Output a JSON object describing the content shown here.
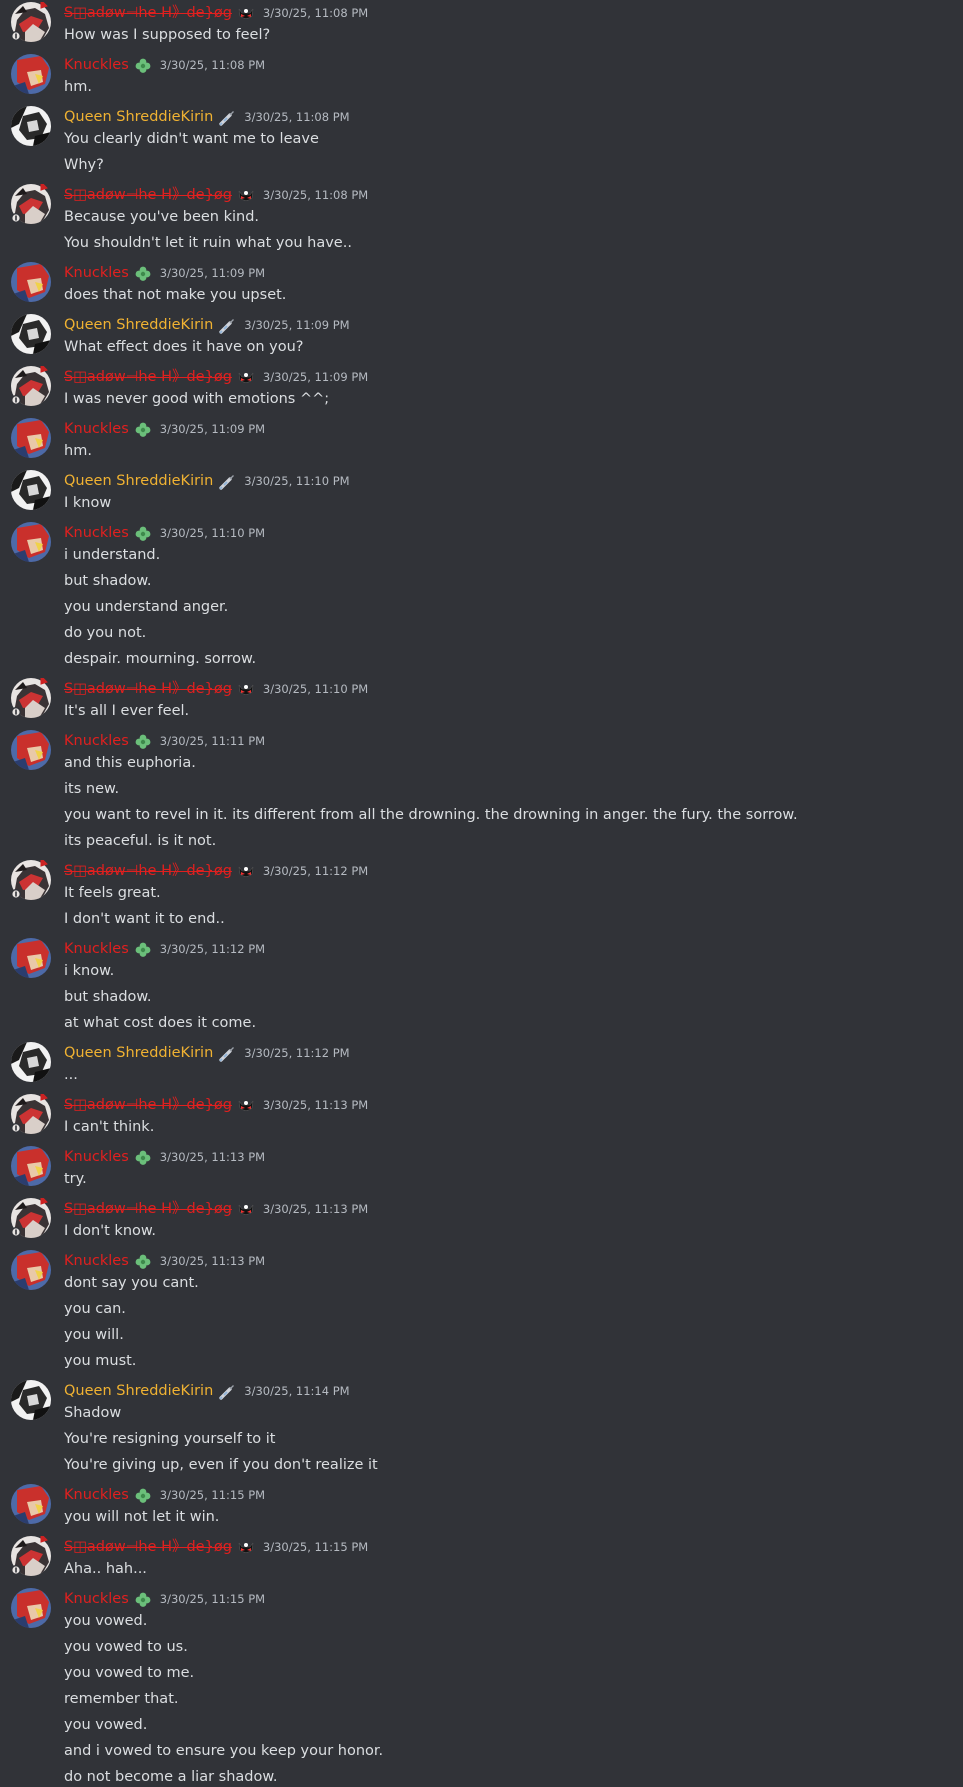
{
  "users": {
    "shadow": {
      "name": "S◫adøw⊣he H》de}øg",
      "color": "#e0201f",
      "strike": true,
      "badge": "cat-mask-icon",
      "avatar": "shadow-avatar"
    },
    "knuckles": {
      "name": "Knuckles",
      "color": "#e0201f",
      "strike": false,
      "badge": "green-flower-icon",
      "avatar": "knuckles-avatar"
    },
    "queen": {
      "name": "Queen ShreddieKirin",
      "color": "#f0b232",
      "strike": false,
      "badge": "syringe-icon",
      "avatar": "queen-avatar"
    }
  },
  "messages": [
    {
      "user": "shadow",
      "time": "3/30/25, 11:08 PM",
      "lines": [
        "How was I supposed to feel?"
      ]
    },
    {
      "user": "knuckles",
      "time": "3/30/25, 11:08 PM",
      "lines": [
        "hm."
      ]
    },
    {
      "user": "queen",
      "time": "3/30/25, 11:08 PM",
      "lines": [
        "You clearly didn't want me to leave",
        "Why?"
      ]
    },
    {
      "user": "shadow",
      "time": "3/30/25, 11:08 PM",
      "lines": [
        "Because you've been kind.",
        "You shouldn't let it ruin what you have.."
      ]
    },
    {
      "user": "knuckles",
      "time": "3/30/25, 11:09 PM",
      "lines": [
        "does that not make you upset."
      ]
    },
    {
      "user": "queen",
      "time": "3/30/25, 11:09 PM",
      "lines": [
        "What effect does it have on you?"
      ]
    },
    {
      "user": "shadow",
      "time": "3/30/25, 11:09 PM",
      "lines": [
        "I was never good with emotions ^^;"
      ]
    },
    {
      "user": "knuckles",
      "time": "3/30/25, 11:09 PM",
      "lines": [
        "hm."
      ]
    },
    {
      "user": "queen",
      "time": "3/30/25, 11:10 PM",
      "lines": [
        "I know"
      ]
    },
    {
      "user": "knuckles",
      "time": "3/30/25, 11:10 PM",
      "lines": [
        "i understand.",
        "but shadow.",
        "you understand anger.",
        "do you not.",
        "despair. mourning. sorrow."
      ]
    },
    {
      "user": "shadow",
      "time": "3/30/25, 11:10 PM",
      "lines": [
        "It's all I ever feel."
      ]
    },
    {
      "user": "knuckles",
      "time": "3/30/25, 11:11 PM",
      "lines": [
        "and this euphoria.",
        "its new.",
        "you want to revel in it. its different from all the drowning. the drowning in anger. the fury. the sorrow.",
        "its peaceful. is it not."
      ]
    },
    {
      "user": "shadow",
      "time": "3/30/25, 11:12 PM",
      "lines": [
        "It feels great.",
        "I don't want it to end.."
      ]
    },
    {
      "user": "knuckles",
      "time": "3/30/25, 11:12 PM",
      "lines": [
        "i know.",
        "but shadow.",
        "at what cost does it come."
      ]
    },
    {
      "user": "queen",
      "time": "3/30/25, 11:12 PM",
      "lines": [
        "..."
      ]
    },
    {
      "user": "shadow",
      "time": "3/30/25, 11:13 PM",
      "lines": [
        "I can't think."
      ]
    },
    {
      "user": "knuckles",
      "time": "3/30/25, 11:13 PM",
      "lines": [
        "try."
      ]
    },
    {
      "user": "shadow",
      "time": "3/30/25, 11:13 PM",
      "lines": [
        "I don't know."
      ]
    },
    {
      "user": "knuckles",
      "time": "3/30/25, 11:13 PM",
      "lines": [
        "dont say you cant.",
        "you can.",
        "you will.",
        "you must."
      ]
    },
    {
      "user": "queen",
      "time": "3/30/25, 11:14 PM",
      "lines": [
        "Shadow",
        "You're resigning yourself to it",
        "You're giving up, even if you don't realize it"
      ]
    },
    {
      "user": "knuckles",
      "time": "3/30/25, 11:15 PM",
      "lines": [
        "you will not let it win."
      ]
    },
    {
      "user": "shadow",
      "time": "3/30/25, 11:15 PM",
      "lines": [
        "Aha.. hah..."
      ]
    },
    {
      "user": "knuckles",
      "time": "3/30/25, 11:15 PM",
      "lines": [
        "you vowed.",
        "you vowed to us.",
        "you vowed to me.",
        "remember that.",
        "you vowed.",
        "and i vowed to ensure you keep your honor.",
        "do not become a liar shadow."
      ]
    }
  ]
}
